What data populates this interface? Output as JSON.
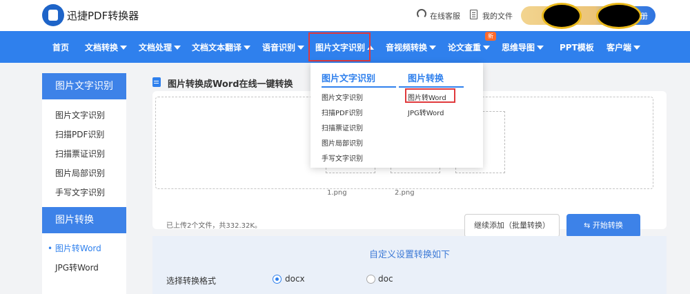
{
  "header": {
    "app_name": "迅捷PDF转换器",
    "support_label": "在线客服",
    "my_files_label": "我的文件",
    "register_label": "册"
  },
  "nav": {
    "items": [
      {
        "label": "首页"
      },
      {
        "label": "文档转换"
      },
      {
        "label": "文档处理"
      },
      {
        "label": "文档文本翻译"
      },
      {
        "label": "语音识别"
      },
      {
        "label": "图片文字识别"
      },
      {
        "label": "音视频转换"
      },
      {
        "label": "论文查重"
      },
      {
        "label": "思维导图"
      },
      {
        "label": "PPT模板"
      },
      {
        "label": "客户端"
      }
    ],
    "new_badge": "新"
  },
  "dropdown": {
    "col1_title": "图片文字识别",
    "col1_items": [
      "图片文字识别",
      "扫描PDF识别",
      "扫描票证识别",
      "图片局部识别",
      "手写文字识别"
    ],
    "col2_title": "图片转换",
    "col2_items": [
      "图片转Word",
      "JPG转Word"
    ]
  },
  "sidebar": {
    "group1_title": "图片文字识别",
    "group1_items": [
      "图片文字识别",
      "扫描PDF识别",
      "扫描票证识别",
      "图片局部识别",
      "手写文字识别"
    ],
    "group2_title": "图片转换",
    "group2_items": [
      "图片转Word",
      "JPG转Word"
    ]
  },
  "main": {
    "title": "图片转换成Word在线一键转换",
    "files": [
      "1.png",
      "2.png"
    ],
    "upload_status": "已上传2个文件，共332.32K。",
    "add_more_label": "继续添加（批量转换）",
    "start_label": "开始转换",
    "settings_title": "自定义设置转换如下",
    "format_label": "选择转换格式",
    "format_options": [
      "docx",
      "doc"
    ]
  }
}
